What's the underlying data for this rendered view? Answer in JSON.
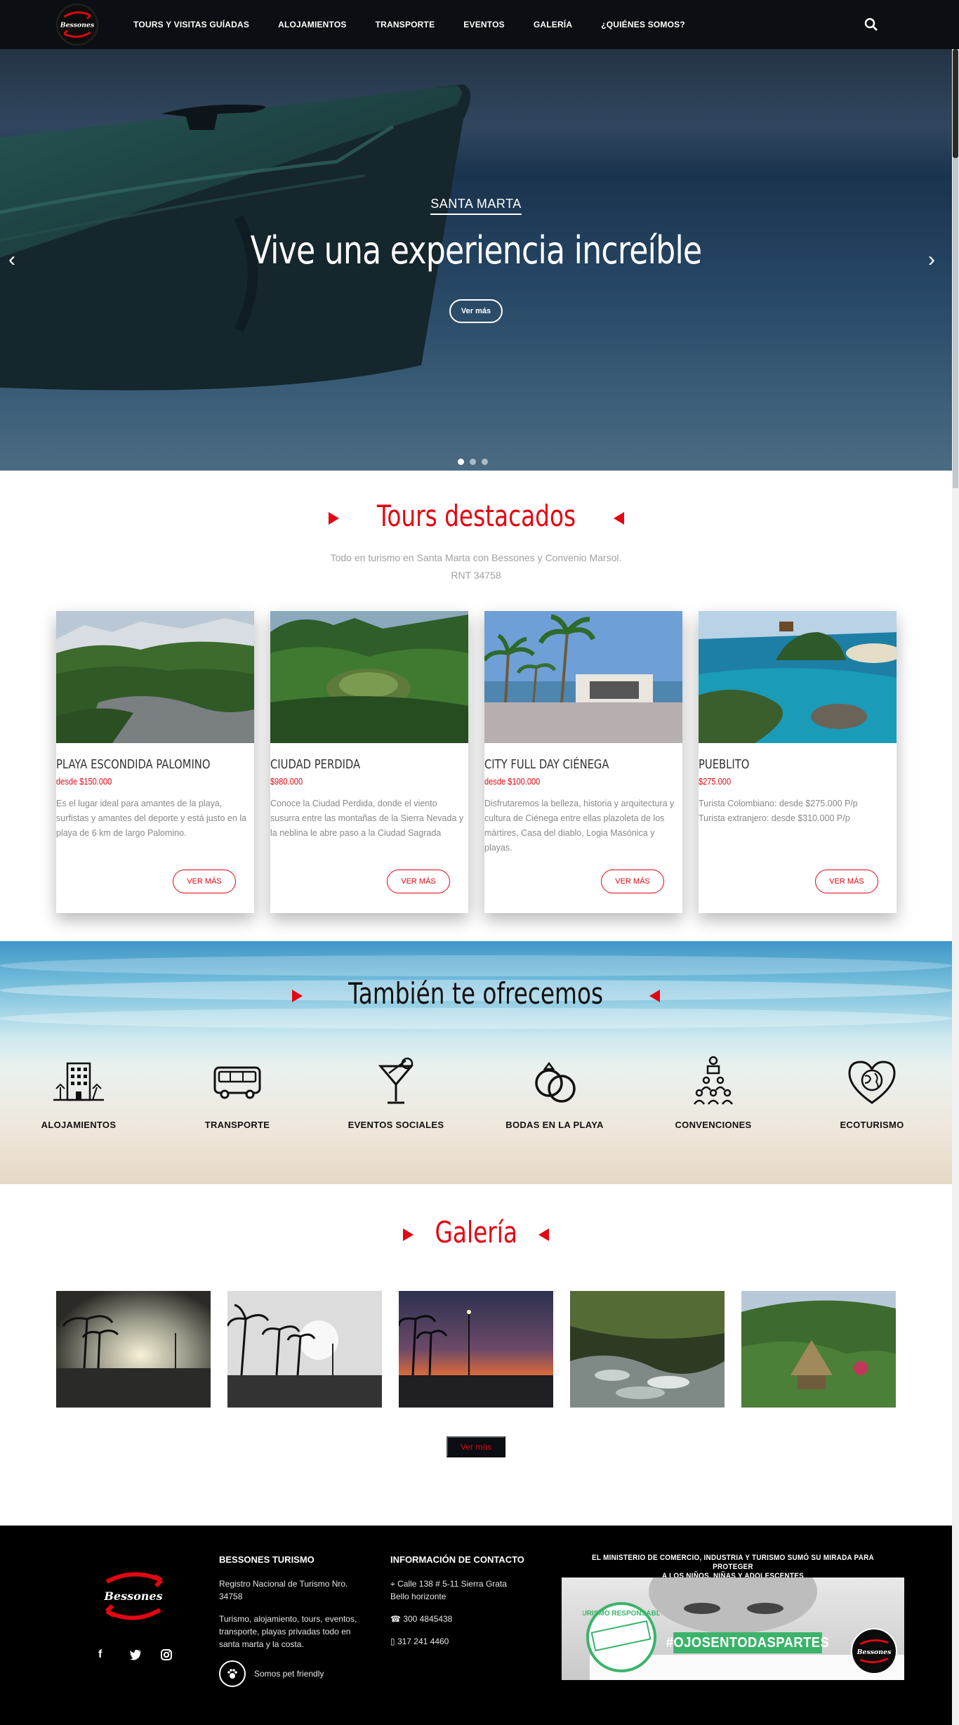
{
  "brand": {
    "name": "Bessones",
    "accent": "#e30613",
    "dark": "#0b0e12"
  },
  "nav": {
    "items": [
      {
        "label": "TOURS Y VISITAS GUÍADAS"
      },
      {
        "label": "ALOJAMIENTOS"
      },
      {
        "label": "TRANSPORTE"
      },
      {
        "label": "EVENTOS"
      },
      {
        "label": "GALERÍA"
      },
      {
        "label": "¿QUIÉNES SOMOS?"
      }
    ],
    "search_icon": "search-icon"
  },
  "hero": {
    "subtitle": "SANTA MARTA",
    "title": "Vive una experiencia increíble",
    "button": "Ver más",
    "slides_count": 3,
    "active_slide": 1
  },
  "tours": {
    "title": "Tours destacados",
    "desc_line1": "Todo en turismo en Santa Marta con Bessones y Convenio Marsol.",
    "desc_line2": "RNT 34758",
    "cards": [
      {
        "title": "PLAYA ESCONDIDA PALOMINO",
        "price": "desde $150.000",
        "desc": "Es el lugar ideal para amantes de la playa, surfistas y amantes del deporte y está justo en la playa de 6 km de largo Palomino.",
        "button": "VER MÁS"
      },
      {
        "title": "CIUDAD PERDIDA",
        "price": "$980.000",
        "desc": "Conoce la Ciudad Perdida, donde el viento susurra entre las montañas de la Sierra Nevada y la neblina le abre paso a la Ciudad Sagrada",
        "button": "VER MÁS"
      },
      {
        "title": "CITY FULL DAY CIÉNEGA",
        "price": "desde $100.000",
        "desc": "Disfrutaremos la belleza, historia y arquitectura y cultura de Ciénega entre ellas plazoleta de los mártires, Casa del diablo, Logia Masónica y playas.",
        "button": "VER MÁS"
      },
      {
        "title": "PUEBLITO",
        "price": "$275.000",
        "desc": "Turista Colombiano: desde $275.000 P/p\nTurista extranjero: desde $310.000 P/p",
        "button": "VER MÁS"
      }
    ]
  },
  "offer": {
    "title": "También te ofrecemos",
    "services": [
      {
        "label": "ALOJAMIENTOS",
        "icon": "hotel-icon"
      },
      {
        "label": "TRANSPORTE",
        "icon": "bus-icon"
      },
      {
        "label": "EVENTOS SOCIALES",
        "icon": "cocktail-icon"
      },
      {
        "label": "BODAS EN LA PLAYA",
        "icon": "rings-icon"
      },
      {
        "label": "CONVENCIONES",
        "icon": "conference-icon"
      },
      {
        "label": "ECOTURISMO",
        "icon": "earth-heart-icon"
      }
    ]
  },
  "gallery": {
    "title": "Galería",
    "button": "Ver más"
  },
  "footer": {
    "col1": {
      "title": "BESSONES TURISMO",
      "rnt": "Registro Nacional de Turismo Nro. 34758",
      "desc": "Turismo, alojamiento, tours, eventos, transporte, playas privadas todo en santa marta y la costa.",
      "pet": "Somos pet friendly"
    },
    "col2": {
      "title": "INFORMACIÓN DE CONTACTO",
      "address_line1": "Calle 138 # 5-11 Sierra Grata",
      "address_line2": "Bello horizonte",
      "phone": "300 4845438",
      "mobile": "317 241 4460"
    },
    "banner": {
      "line1": "EL MINISTERIO DE COMERCIO, INDUSTRIA Y TURISMO SUMÓ SU MIRADA PARA PROTEGER",
      "line2": "A LOS NIÑOS, NIÑAS Y ADOLESCENTES",
      "hashtag": "#OJOSENTODASPARTES",
      "seal": "TURISMO RESPONSABLE",
      "logo": "Bessones"
    }
  }
}
